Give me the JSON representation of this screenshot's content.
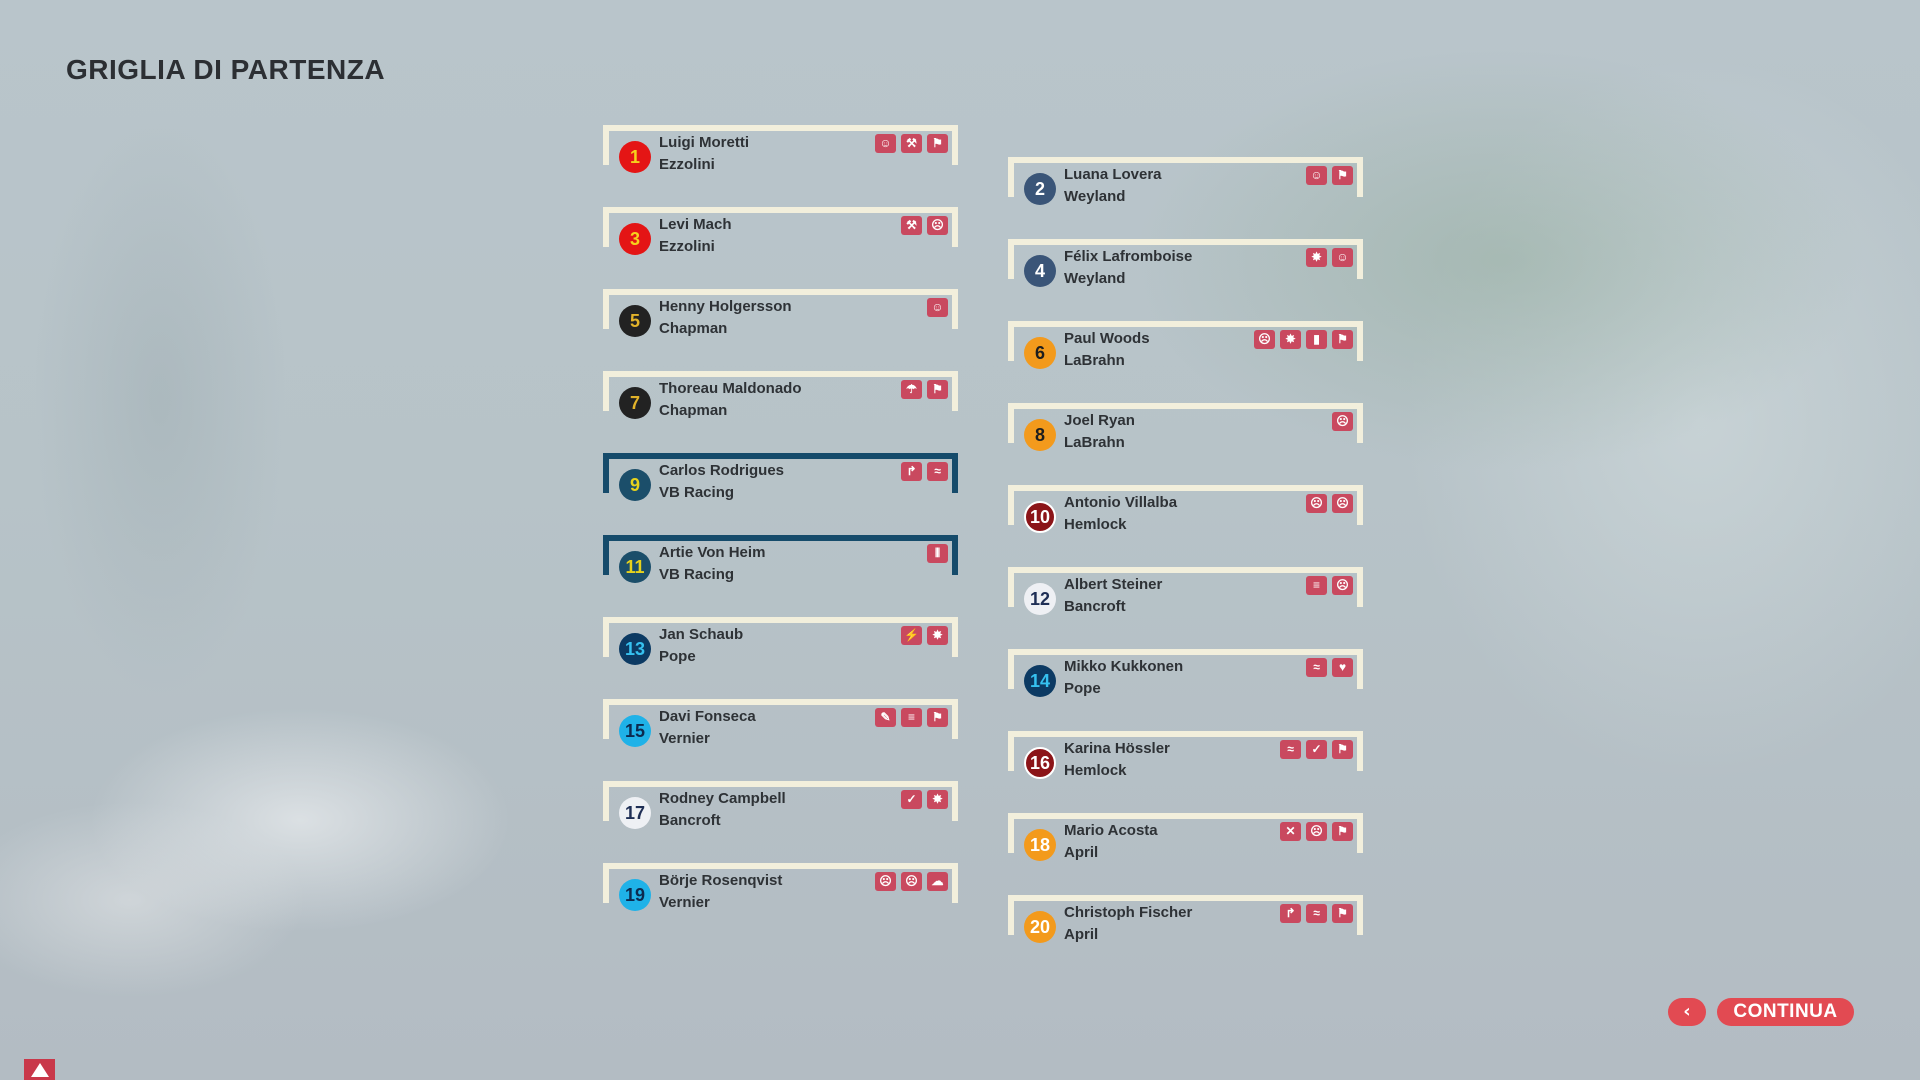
{
  "page_title": "GRIGLIA DI PARTENZA",
  "buttons": {
    "back_symbol": "‹",
    "continue_label": "CONTINUA"
  },
  "colors": {
    "card_border": "#f2efdc",
    "highlight_border": "#154b6b",
    "icon_bg": "#c9495f",
    "button_bg": "#e24a52"
  },
  "grid": [
    {
      "pos": "1",
      "name": "Luigi Moretti",
      "team": "Ezzolini",
      "badge_bg": "#e41515",
      "badge_fg": "#f6d21c",
      "badge_border": "",
      "icons": [
        "smile-icon",
        "wrench-icon",
        "flag-icon"
      ],
      "highlight": false
    },
    {
      "pos": "2",
      "name": "Luana Lovera",
      "team": "Weyland",
      "badge_bg": "#3a5578",
      "badge_fg": "#ffffff",
      "badge_border": "",
      "icons": [
        "smile-icon",
        "flag-icon"
      ],
      "highlight": false
    },
    {
      "pos": "3",
      "name": "Levi Mach",
      "team": "Ezzolini",
      "badge_bg": "#e41515",
      "badge_fg": "#f6d21c",
      "badge_border": "",
      "icons": [
        "wrench-icon",
        "angry-icon"
      ],
      "highlight": false
    },
    {
      "pos": "4",
      "name": "Félix Lafromboise",
      "team": "Weyland",
      "badge_bg": "#3a5578",
      "badge_fg": "#ffffff",
      "badge_border": "",
      "icons": [
        "burst-icon",
        "smile-icon"
      ],
      "highlight": false
    },
    {
      "pos": "5",
      "name": "Henny Holgersson",
      "team": "Chapman",
      "badge_bg": "#222222",
      "badge_fg": "#e2b32a",
      "badge_border": "",
      "icons": [
        "smile-icon"
      ],
      "highlight": false
    },
    {
      "pos": "6",
      "name": "Paul Woods",
      "team": "LaBrahn",
      "badge_bg": "#f39a1c",
      "badge_fg": "#1e1e1e",
      "badge_border": "",
      "icons": [
        "angry-icon",
        "burst-icon",
        "chart-icon",
        "flag-icon"
      ],
      "highlight": false
    },
    {
      "pos": "7",
      "name": "Thoreau Maldonado",
      "team": "Chapman",
      "badge_bg": "#222222",
      "badge_fg": "#e2b32a",
      "badge_border": "",
      "icons": [
        "umbrella-icon",
        "flag-icon"
      ],
      "highlight": false
    },
    {
      "pos": "8",
      "name": "Joel Ryan",
      "team": "LaBrahn",
      "badge_bg": "#f39a1c",
      "badge_fg": "#1e1e1e",
      "badge_border": "",
      "icons": [
        "angry-icon"
      ],
      "highlight": false
    },
    {
      "pos": "9",
      "name": "Carlos Rodrigues",
      "team": "VB Racing",
      "badge_bg": "#1b4e6a",
      "badge_fg": "#e7d21c",
      "badge_border": "",
      "icons": [
        "arm-icon",
        "grin-icon"
      ],
      "highlight": true
    },
    {
      "pos": "10",
      "name": "Antonio Villalba",
      "team": "Hemlock",
      "badge_bg": "#8b1418",
      "badge_fg": "#ffffff",
      "badge_border": "#ffffff",
      "icons": [
        "sad-icon",
        "angry-icon"
      ],
      "highlight": false
    },
    {
      "pos": "11",
      "name": "Artie Von Heim",
      "team": "VB Racing",
      "badge_bg": "#1b4e6a",
      "badge_fg": "#e7d21c",
      "badge_border": "",
      "icons": [
        "signal-icon"
      ],
      "highlight": true
    },
    {
      "pos": "12",
      "name": "Albert Steiner",
      "team": "Bancroft",
      "badge_bg": "#eef0f4",
      "badge_fg": "#1e2e55",
      "badge_border": "",
      "icons": [
        "neutral-icon",
        "angry-icon"
      ],
      "highlight": false
    },
    {
      "pos": "13",
      "name": "Jan Schaub",
      "team": "Pope",
      "badge_bg": "#0c3a63",
      "badge_fg": "#36c1f0",
      "badge_border": "",
      "icons": [
        "crash-icon",
        "burst-icon"
      ],
      "highlight": false
    },
    {
      "pos": "14",
      "name": "Mikko Kukkonen",
      "team": "Pope",
      "badge_bg": "#0c3a63",
      "badge_fg": "#36c1f0",
      "badge_border": "",
      "icons": [
        "grin-icon",
        "heart-icon"
      ],
      "highlight": false
    },
    {
      "pos": "15",
      "name": "Davi Fonseca",
      "team": "Vernier",
      "badge_bg": "#1fb2e8",
      "badge_fg": "#0c2a4f",
      "badge_border": "",
      "icons": [
        "candy-icon",
        "neutral-icon",
        "flag-icon"
      ],
      "highlight": false
    },
    {
      "pos": "16",
      "name": "Karina Hössler",
      "team": "Hemlock",
      "badge_bg": "#8b1418",
      "badge_fg": "#ffffff",
      "badge_border": "#ffffff",
      "icons": [
        "grin-icon",
        "check-icon",
        "flag-icon"
      ],
      "highlight": false
    },
    {
      "pos": "17",
      "name": "Rodney Campbell",
      "team": "Bancroft",
      "badge_bg": "#eef0f4",
      "badge_fg": "#1e2e55",
      "badge_border": "",
      "icons": [
        "check-icon",
        "burst-icon"
      ],
      "highlight": false
    },
    {
      "pos": "18",
      "name": "Mario Acosta",
      "team": "April",
      "badge_bg": "#f39a1c",
      "badge_fg": "#ffffff",
      "badge_border": "",
      "icons": [
        "cross-icon",
        "angry-icon",
        "flag-icon"
      ],
      "highlight": false
    },
    {
      "pos": "19",
      "name": "Börje Rosenqvist",
      "team": "Vernier",
      "badge_bg": "#1fb2e8",
      "badge_fg": "#0c2a4f",
      "badge_border": "",
      "icons": [
        "sad-icon",
        "angry-icon",
        "cloud-icon"
      ],
      "highlight": false
    },
    {
      "pos": "20",
      "name": "Christoph Fischer",
      "team": "April",
      "badge_bg": "#f39a1c",
      "badge_fg": "#ffffff",
      "badge_border": "",
      "icons": [
        "arm-icon",
        "grin-icon",
        "flag-icon"
      ],
      "highlight": false
    }
  ]
}
